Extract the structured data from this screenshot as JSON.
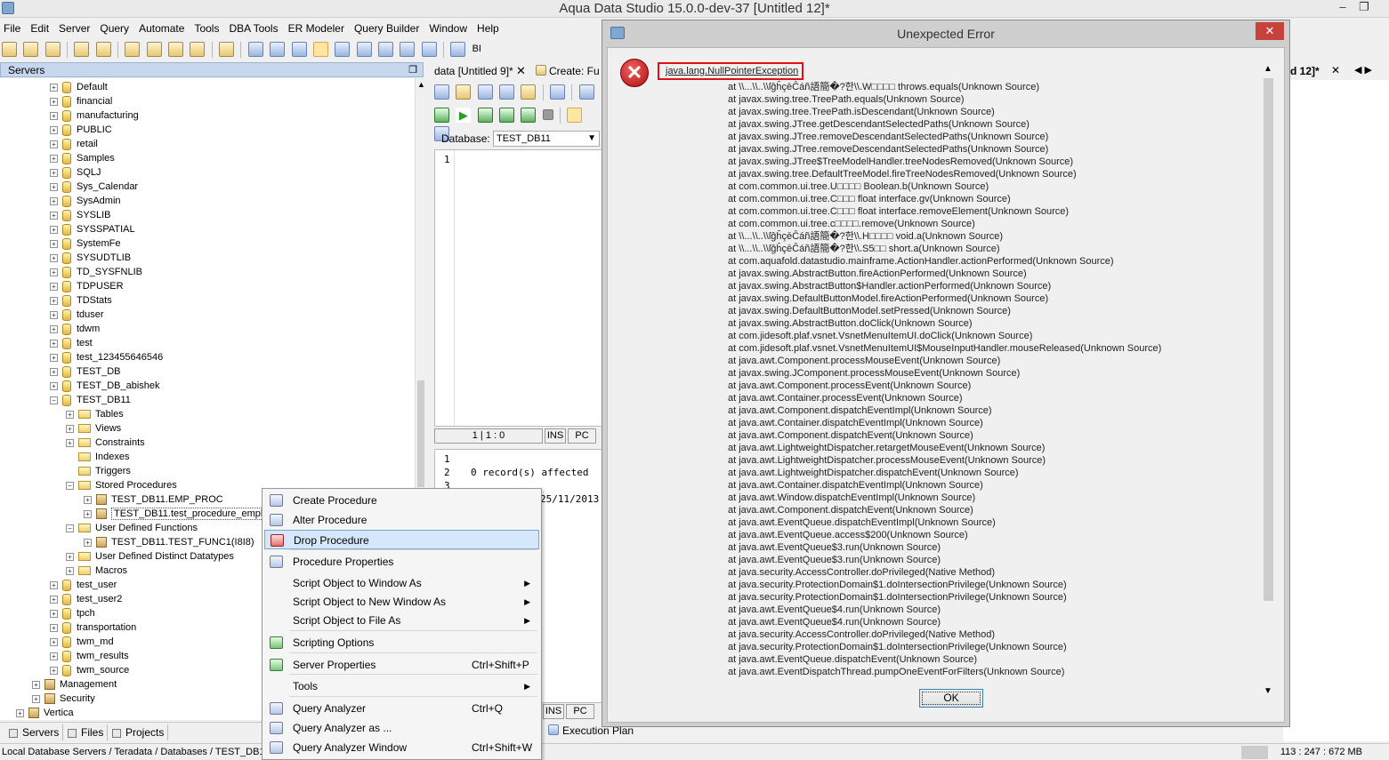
{
  "window": {
    "title": "Aqua Data Studio 15.0.0-dev-37 [Untitled 12]*",
    "minimize": "–",
    "restore": "❐"
  },
  "menubar": [
    "File",
    "Edit",
    "Server",
    "Query",
    "Automate",
    "Tools",
    "DBA Tools",
    "ER Modeler",
    "Query Builder",
    "Window",
    "Help"
  ],
  "toolbar": {
    "bi_label": "BI"
  },
  "servers_panel": {
    "title": "Servers",
    "tree": [
      {
        "label": "Default",
        "icon": "database-icon",
        "level": 1
      },
      {
        "label": "financial",
        "icon": "database-icon",
        "level": 1
      },
      {
        "label": "manufacturing",
        "icon": "database-icon",
        "level": 1
      },
      {
        "label": "PUBLIC",
        "icon": "locked-database-icon",
        "level": 1
      },
      {
        "label": "retail",
        "icon": "database-icon",
        "level": 1
      },
      {
        "label": "Samples",
        "icon": "database-icon",
        "level": 1
      },
      {
        "label": "SQLJ",
        "icon": "database-icon",
        "level": 1
      },
      {
        "label": "Sys_Calendar",
        "icon": "locked-database-icon",
        "level": 1
      },
      {
        "label": "SysAdmin",
        "icon": "locked-database-icon",
        "level": 1
      },
      {
        "label": "SYSLIB",
        "icon": "database-icon",
        "level": 1
      },
      {
        "label": "SYSSPATIAL",
        "icon": "database-icon",
        "level": 1
      },
      {
        "label": "SystemFe",
        "icon": "locked-database-icon",
        "level": 1
      },
      {
        "label": "SYSUDTLIB",
        "icon": "database-icon",
        "level": 1
      },
      {
        "label": "TD_SYSFNLIB",
        "icon": "database-icon",
        "level": 1
      },
      {
        "label": "TDPUSER",
        "icon": "locked-database-icon",
        "level": 1
      },
      {
        "label": "TDStats",
        "icon": "database-icon",
        "level": 1
      },
      {
        "label": "tduser",
        "icon": "locked-database-icon",
        "level": 1
      },
      {
        "label": "tdwm",
        "icon": "locked-database-icon",
        "level": 1
      },
      {
        "label": "test",
        "icon": "locked-database-icon",
        "level": 1
      },
      {
        "label": "test_123455646546",
        "icon": "database-icon",
        "level": 1
      },
      {
        "label": "TEST_DB",
        "icon": "database-icon",
        "level": 1
      },
      {
        "label": "TEST_DB_abishek",
        "icon": "database-icon",
        "level": 1
      },
      {
        "label": "TEST_DB11",
        "icon": "database-icon",
        "level": 1,
        "expanded": true
      },
      {
        "label": "Tables",
        "icon": "folder-icon",
        "level": 2
      },
      {
        "label": "Views",
        "icon": "folder-icon",
        "level": 2
      },
      {
        "label": "Constraints",
        "icon": "folder-icon",
        "level": 2
      },
      {
        "label": "Indexes",
        "icon": "folder-icon",
        "level": 2,
        "leaf": true
      },
      {
        "label": "Triggers",
        "icon": "folder-icon",
        "level": 2,
        "leaf": true
      },
      {
        "label": "Stored Procedures",
        "icon": "folder-icon",
        "level": 2,
        "expanded": true
      },
      {
        "label": "TEST_DB11.EMP_PROC",
        "icon": "procedure-icon",
        "level": 3
      },
      {
        "label": "TEST_DB11.test_procedure_employee",
        "icon": "procedure-icon",
        "level": 3,
        "selected": true
      },
      {
        "label": "User Defined Functions",
        "icon": "folder-icon",
        "level": 2,
        "expanded": true
      },
      {
        "label": "TEST_DB11.TEST_FUNC1(I8I8)",
        "icon": "function-icon",
        "level": 3
      },
      {
        "label": "User Defined Distinct Datatypes",
        "icon": "folder-icon",
        "level": 2
      },
      {
        "label": "Macros",
        "icon": "folder-icon",
        "level": 2
      },
      {
        "label": "test_user",
        "icon": "locked-database-icon",
        "level": 1
      },
      {
        "label": "test_user2",
        "icon": "locked-database-icon",
        "level": 1
      },
      {
        "label": "tpch",
        "icon": "database-icon",
        "level": 1
      },
      {
        "label": "transportation",
        "icon": "database-icon",
        "level": 1
      },
      {
        "label": "twm_md",
        "icon": "database-icon",
        "level": 1
      },
      {
        "label": "twm_results",
        "icon": "database-icon",
        "level": 1
      },
      {
        "label": "twm_source",
        "icon": "database-icon",
        "level": 1
      },
      {
        "label": "Management",
        "icon": "management-icon",
        "level": 0
      },
      {
        "label": "Security",
        "icon": "security-icon",
        "level": 0
      },
      {
        "label": "Vertica",
        "icon": "server-icon",
        "level": -1
      }
    ]
  },
  "bottom_tabs": [
    "Servers",
    "Files",
    "Projects"
  ],
  "status": {
    "path": "Local Database Servers / Teradata / Databases / TEST_DB11",
    "memory": "113 : 247 : 672 MB"
  },
  "editor": {
    "tab1": "data [Untitled 9]*",
    "tab2": "Create: Fu",
    "tab_close": "✕",
    "database_label": "Database:",
    "database_value": "TEST_DB11",
    "line_numbers": [
      "1"
    ],
    "cursor": "1 | 1 : 0",
    "ins": "INS",
    "pc": "PC",
    "result_line_numbers": [
      "1",
      "2",
      "3"
    ],
    "result_lines": [
      "",
      "0 record(s) affected ",
      ""
    ],
    "result_date": "25/11/2013",
    "execution_plan": "Execution Plan",
    "right_tab": "d 12]*"
  },
  "context_menu": [
    {
      "label": "Create Procedure",
      "shortcut": "",
      "submenu": false,
      "icon": "create-procedure-icon"
    },
    {
      "label": "Alter Procedure",
      "shortcut": "",
      "submenu": false,
      "icon": "alter-procedure-icon"
    },
    {
      "label": "Drop Procedure",
      "shortcut": "",
      "submenu": false,
      "icon": "drop-procedure-icon",
      "highlighted": true
    },
    {
      "label": "Procedure Properties",
      "shortcut": "",
      "submenu": false,
      "icon": "properties-icon"
    },
    {
      "label": "Script Object to Window As",
      "shortcut": "",
      "submenu": true
    },
    {
      "label": "Script Object to New Window As",
      "shortcut": "",
      "submenu": true
    },
    {
      "label": "Script Object to File As",
      "shortcut": "",
      "submenu": true
    },
    {
      "label": "Scripting Options",
      "shortcut": "",
      "submenu": false,
      "icon": "scripting-options-icon"
    },
    {
      "label": "Server Properties",
      "shortcut": "Ctrl+Shift+P",
      "submenu": false,
      "icon": "server-properties-icon"
    },
    {
      "label": "Tools",
      "shortcut": "",
      "submenu": true
    },
    {
      "label": "Query Analyzer",
      "shortcut": "Ctrl+Q",
      "submenu": false,
      "icon": "query-analyzer-icon"
    },
    {
      "label": "Query Analyzer as ...",
      "shortcut": "",
      "submenu": false,
      "icon": "query-analyzer-as-icon"
    },
    {
      "label": "Query Analyzer Window",
      "shortcut": "Ctrl+Shift+W",
      "submenu": false,
      "icon": "query-analyzer-window-icon"
    }
  ],
  "dialog": {
    "title": "Unexpected Error",
    "close": "✕",
    "exception": "java.lang.NullPointerException",
    "stack_trace": [
      "at \\\\...\\\\..\\\\ſĝĥçēĈáñ語簡�?한\\\\.W□□□□ throws.equals(Unknown Source)",
      "at javax.swing.tree.TreePath.equals(Unknown Source)",
      "at javax.swing.tree.TreePath.isDescendant(Unknown Source)",
      "at javax.swing.JTree.getDescendantSelectedPaths(Unknown Source)",
      "at javax.swing.JTree.removeDescendantSelectedPaths(Unknown Source)",
      "at javax.swing.JTree.removeDescendantSelectedPaths(Unknown Source)",
      "at javax.swing.JTree$TreeModelHandler.treeNodesRemoved(Unknown Source)",
      "at javax.swing.tree.DefaultTreeModel.fireTreeNodesRemoved(Unknown Source)",
      "at com.common.ui.tree.U□□□□ Boolean.b(Unknown Source)",
      "at com.common.ui.tree.C□□□ float interface.gv(Unknown Source)",
      "at com.common.ui.tree.C□□□ float interface.removeElement(Unknown Source)",
      "at com.common.ui.tree.c□□□□.remove(Unknown Source)",
      "at \\\\...\\\\..\\\\ſĝĥçēĈáñ語簡�?한\\\\.H□□□□ void.a(Unknown Source)",
      "at \\\\...\\\\..\\\\ſĝĥçēĈáñ語簡�?한\\\\.S5□□ short.a(Unknown Source)",
      "at com.aquafold.datastudio.mainframe.ActionHandler.actionPerformed(Unknown Source)",
      "at javax.swing.AbstractButton.fireActionPerformed(Unknown Source)",
      "at javax.swing.AbstractButton$Handler.actionPerformed(Unknown Source)",
      "at javax.swing.DefaultButtonModel.fireActionPerformed(Unknown Source)",
      "at javax.swing.DefaultButtonModel.setPressed(Unknown Source)",
      "at javax.swing.AbstractButton.doClick(Unknown Source)",
      "at com.jidesoft.plaf.vsnet.VsnetMenuItemUI.doClick(Unknown Source)",
      "at com.jidesoft.plaf.vsnet.VsnetMenuItemUI$MouseInputHandler.mouseReleased(Unknown Source)",
      "at java.awt.Component.processMouseEvent(Unknown Source)",
      "at javax.swing.JComponent.processMouseEvent(Unknown Source)",
      "at java.awt.Component.processEvent(Unknown Source)",
      "at java.awt.Container.processEvent(Unknown Source)",
      "at java.awt.Component.dispatchEventImpl(Unknown Source)",
      "at java.awt.Container.dispatchEventImpl(Unknown Source)",
      "at java.awt.Component.dispatchEvent(Unknown Source)",
      "at java.awt.LightweightDispatcher.retargetMouseEvent(Unknown Source)",
      "at java.awt.LightweightDispatcher.processMouseEvent(Unknown Source)",
      "at java.awt.LightweightDispatcher.dispatchEvent(Unknown Source)",
      "at java.awt.Container.dispatchEventImpl(Unknown Source)",
      "at java.awt.Window.dispatchEventImpl(Unknown Source)",
      "at java.awt.Component.dispatchEvent(Unknown Source)",
      "at java.awt.EventQueue.dispatchEventImpl(Unknown Source)",
      "at java.awt.EventQueue.access$200(Unknown Source)",
      "at java.awt.EventQueue$3.run(Unknown Source)",
      "at java.awt.EventQueue$3.run(Unknown Source)",
      "at java.security.AccessController.doPrivileged(Native Method)",
      "at java.security.ProtectionDomain$1.doIntersectionPrivilege(Unknown Source)",
      "at java.security.ProtectionDomain$1.doIntersectionPrivilege(Unknown Source)",
      "at java.awt.EventQueue$4.run(Unknown Source)",
      "at java.awt.EventQueue$4.run(Unknown Source)",
      "at java.security.AccessController.doPrivileged(Native Method)",
      "at java.security.ProtectionDomain$1.doIntersectionPrivilege(Unknown Source)",
      "at java.awt.EventQueue.dispatchEvent(Unknown Source)",
      "at java.awt.EventDispatchThread.pumpOneEventForFilters(Unknown Source)"
    ],
    "ok_label": "OK"
  },
  "colors": {
    "accent": "#3c7fb1",
    "error": "#e01010",
    "highlight": "#d5e8fb",
    "close_button": "#c7423b"
  }
}
